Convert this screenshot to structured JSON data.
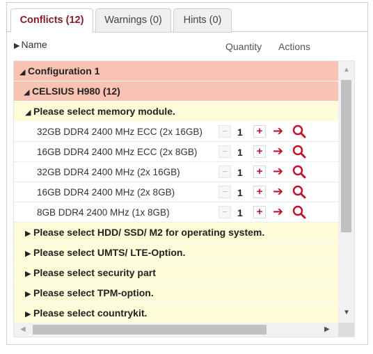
{
  "tabs": [
    {
      "label": "Conflicts (12)"
    },
    {
      "label": "Warnings (0)"
    },
    {
      "label": "Hints (0)"
    }
  ],
  "header": {
    "name": "Name",
    "quantity": "Quantity",
    "actions": "Actions"
  },
  "configuration": {
    "label": "Configuration 1"
  },
  "product": {
    "label": "CELSIUS H980 (12)"
  },
  "memory_group": {
    "label": "Please select memory module."
  },
  "items": [
    {
      "label": "32GB DDR4 2400 MHz ECC (2x 16GB)",
      "qty": "1"
    },
    {
      "label": "16GB DDR4 2400 MHz ECC (2x 8GB)",
      "qty": "1"
    },
    {
      "label": "32GB DDR4 2400 MHz (2x 16GB)",
      "qty": "1"
    },
    {
      "label": "16GB DDR4 2400 MHz (2x 8GB)",
      "qty": "1"
    },
    {
      "label": "8GB DDR4 2400 MHz (1x 8GB)",
      "qty": "1"
    }
  ],
  "groups": [
    {
      "label": "Please select HDD/ SSD/ M2 for operating system."
    },
    {
      "label": "Please select UMTS/ LTE-Option."
    },
    {
      "label": "Please select security part"
    },
    {
      "label": "Please select TPM-option."
    },
    {
      "label": "Please select countrykit."
    }
  ],
  "icons": {
    "expanded": "triangle-down-right",
    "collapsed": "triangle-right",
    "arrow": "arrow-right-icon",
    "search": "magnifier-icon"
  },
  "colors": {
    "accent": "#c0142a",
    "config_bg": "#f8c3b3",
    "group_bg": "#fefbd8",
    "active_tab": "#8a1a2a"
  }
}
